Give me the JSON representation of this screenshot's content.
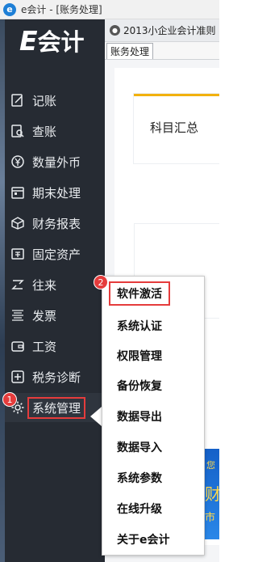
{
  "window": {
    "title": "e会计 - [账务处理]"
  },
  "brand": {
    "logo_letter": "E",
    "name": "会计"
  },
  "sidebar": {
    "items": [
      {
        "label": "记账",
        "icon": "edit-icon"
      },
      {
        "label": "查账",
        "icon": "search-doc-icon"
      },
      {
        "label": "数量外币",
        "icon": "yen-icon"
      },
      {
        "label": "期末处理",
        "icon": "calendar-icon"
      },
      {
        "label": "财务报表",
        "icon": "cube-icon"
      },
      {
        "label": "固定资产",
        "icon": "asset-icon"
      },
      {
        "label": "往来",
        "icon": "transfer-icon"
      },
      {
        "label": "发票",
        "icon": "invoice-icon"
      },
      {
        "label": "工资",
        "icon": "wallet-icon"
      },
      {
        "label": "税务诊断",
        "icon": "plus-square-icon"
      },
      {
        "label": "系统管理",
        "icon": "gear-icon"
      }
    ]
  },
  "main": {
    "doc_title": "2013小企业会计准则",
    "tab_label": "账务处理",
    "summary_title": "科目汇总",
    "promo_chars": [
      "您",
      "财",
      "市"
    ]
  },
  "popup": {
    "items": [
      "软件激活",
      "系统认证",
      "权限管理",
      "备份恢复",
      "数据导出",
      "数据导入",
      "系统参数",
      "在线升级",
      "关于e会计"
    ]
  },
  "badges": {
    "step1": "1",
    "step2": "2"
  },
  "colors": {
    "sidebar": "#262b33",
    "highlight": "#e53c3c",
    "accent": "#f2b10e"
  }
}
